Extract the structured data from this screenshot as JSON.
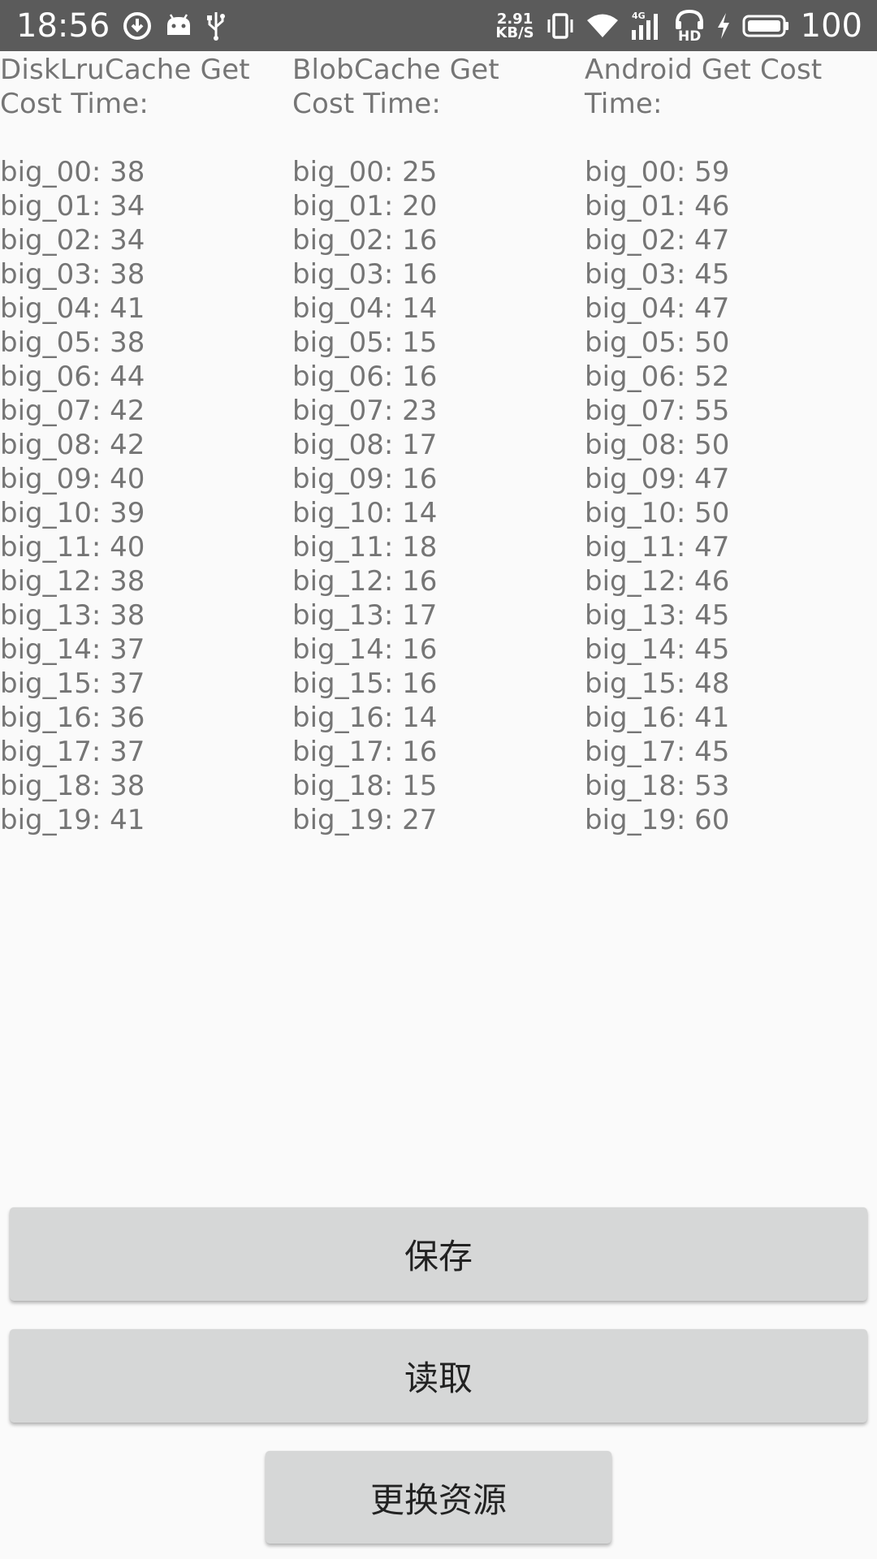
{
  "status_bar": {
    "time": "18:56",
    "net_speed_value": "2.91",
    "net_speed_unit": "KB/S",
    "network_type": "4G",
    "hd_label": "HD",
    "battery_level": "100",
    "icons": [
      "download-icon",
      "android-icon",
      "usb-icon",
      "vibrate-icon",
      "wifi-icon",
      "signal-icon",
      "hd-call-icon",
      "charging-icon",
      "battery-icon"
    ]
  },
  "columns": [
    {
      "header": "DiskLruCache Get Cost Time:",
      "lines": [
        "big_00: 38",
        "big_01: 34",
        "big_02: 34",
        "big_03: 38",
        "big_04: 41",
        "big_05: 38",
        "big_06: 44",
        "big_07: 42",
        "big_08: 42",
        "big_09: 40",
        "big_10: 39",
        "big_11: 40",
        "big_12: 38",
        "big_13: 38",
        "big_14: 37",
        "big_15: 37",
        "big_16: 36",
        "big_17: 37",
        "big_18: 38",
        "big_19: 41"
      ]
    },
    {
      "header": "BlobCache Get Cost Time:",
      "lines": [
        "big_00: 25",
        "big_01: 20",
        "big_02: 16",
        "big_03: 16",
        "big_04: 14",
        "big_05: 15",
        "big_06: 16",
        "big_07: 23",
        "big_08: 17",
        "big_09: 16",
        "big_10: 14",
        "big_11: 18",
        "big_12: 16",
        "big_13: 17",
        "big_14: 16",
        "big_15: 16",
        "big_16: 14",
        "big_17: 16",
        "big_18: 15",
        "big_19: 27"
      ]
    },
    {
      "header": "Android Get Cost Time:",
      "lines": [
        "big_00: 59",
        "big_01: 46",
        "big_02: 47",
        "big_03: 45",
        "big_04: 47",
        "big_05: 50",
        "big_06: 52",
        "big_07: 55",
        "big_08: 50",
        "big_09: 47",
        "big_10: 50",
        "big_11: 47",
        "big_12: 46",
        "big_13: 45",
        "big_14: 45",
        "big_15: 48",
        "big_16: 41",
        "big_17: 45",
        "big_18: 53",
        "big_19: 60"
      ]
    }
  ],
  "buttons": {
    "save_label": "保存",
    "read_label": "读取",
    "change_resource_label": "更换资源"
  }
}
